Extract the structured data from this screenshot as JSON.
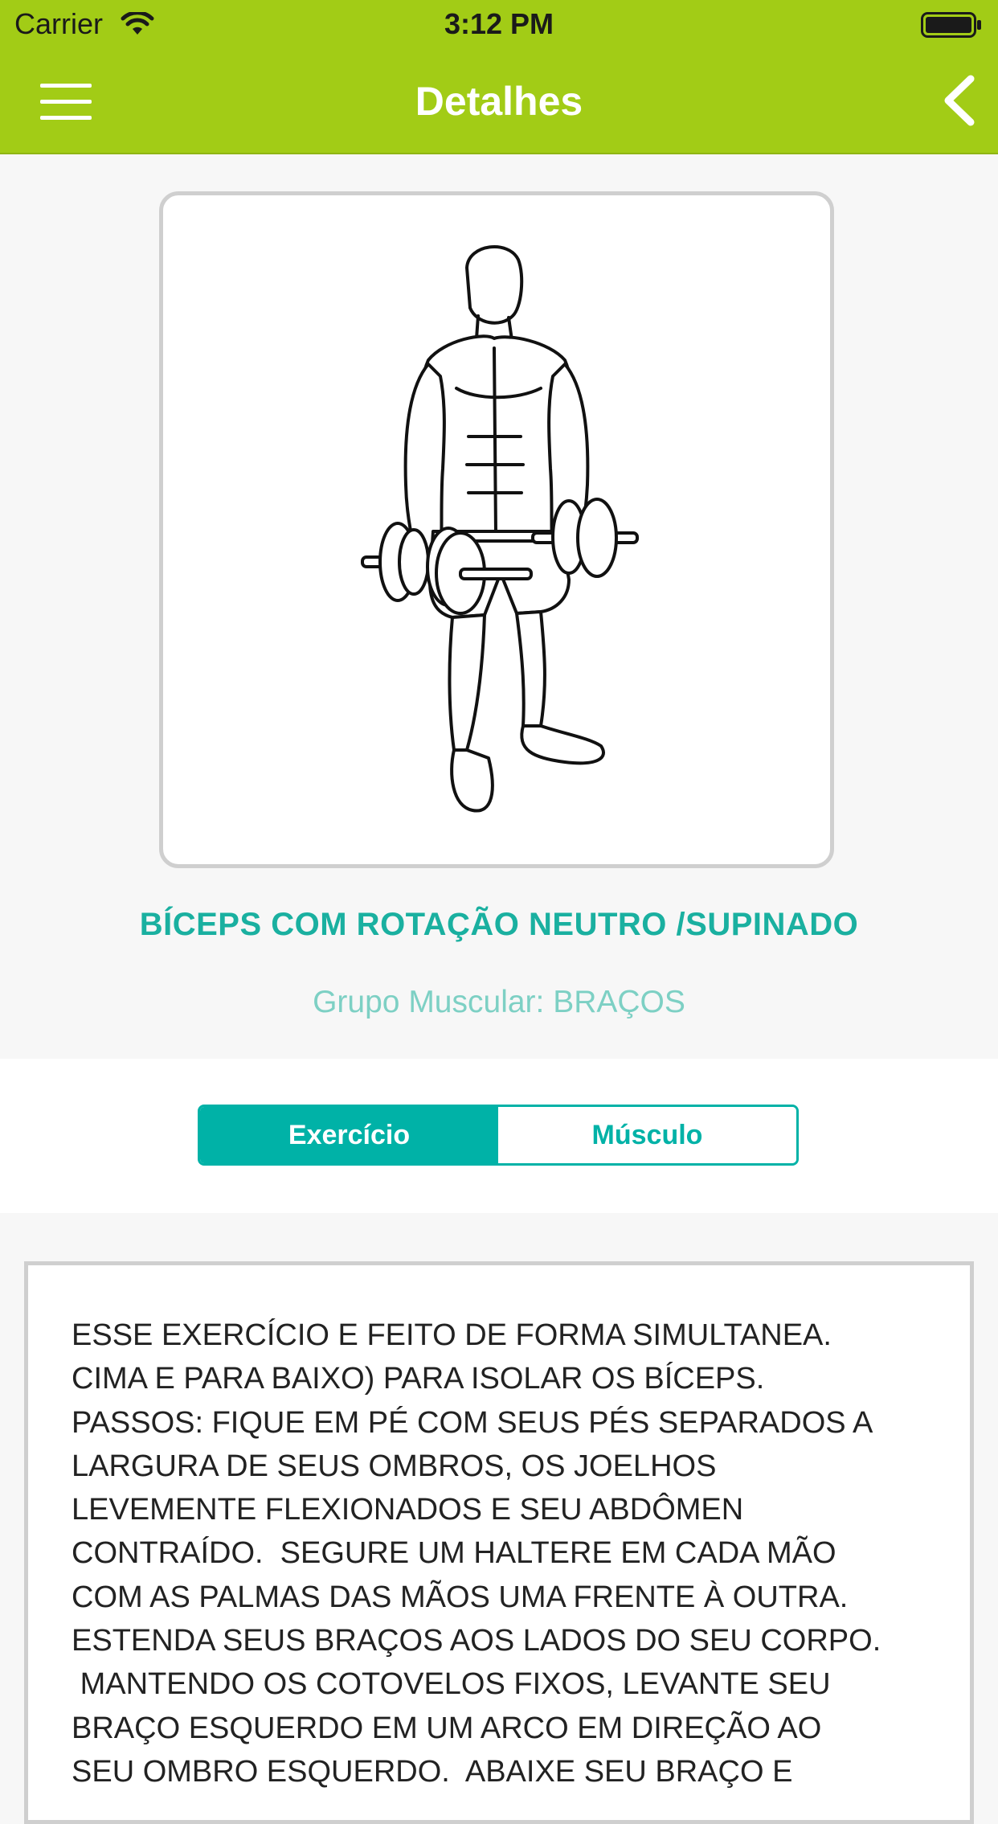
{
  "status_bar": {
    "carrier": "Carrier",
    "time": "3:12 PM"
  },
  "nav": {
    "title": "Detalhes",
    "menu_icon": "hamburger-icon",
    "back_icon": "chevron-left-icon"
  },
  "colors": {
    "header": "#a2cc16",
    "accent": "#00b2a7",
    "title_text": "#1ab0a0",
    "subtitle_text": "#7dd0c4"
  },
  "exercise": {
    "image": "exercise-illustration",
    "title": "BÍCEPS COM ROTAÇÃO NEUTRO /SUPINADO",
    "muscle_group": "Grupo Muscular: BRAÇOS"
  },
  "tabs": [
    {
      "label": "Exercício",
      "selected": true
    },
    {
      "label": "Músculo",
      "selected": false
    }
  ],
  "description": "ESSE EXERCÍCIO E FEITO DE FORMA SIMULTANEA.\nCIMA E PARA BAIXO) PARA ISOLAR OS BÍCEPS.\nPASSOS: FIQUE EM PÉ COM SEUS PÉS SEPARADOS A\nLARGURA DE SEUS OMBROS, OS JOELHOS\nLEVEMENTE FLEXIONADOS E SEU ABDÔMEN\nCONTRAÍDO.  SEGURE UM HALTERE EM CADA MÃO\nCOM AS PALMAS DAS MÃOS UMA FRENTE À OUTRA.\nESTENDA SEUS BRAÇOS AOS LADOS DO SEU CORPO.\n MANTENDO OS COTOVELOS FIXOS, LEVANTE SEU\nBRAÇO ESQUERDO EM UM ARCO EM DIREÇÃO AO\nSEU OMBRO ESQUERDO.  ABAIXE SEU BRAÇO E"
}
